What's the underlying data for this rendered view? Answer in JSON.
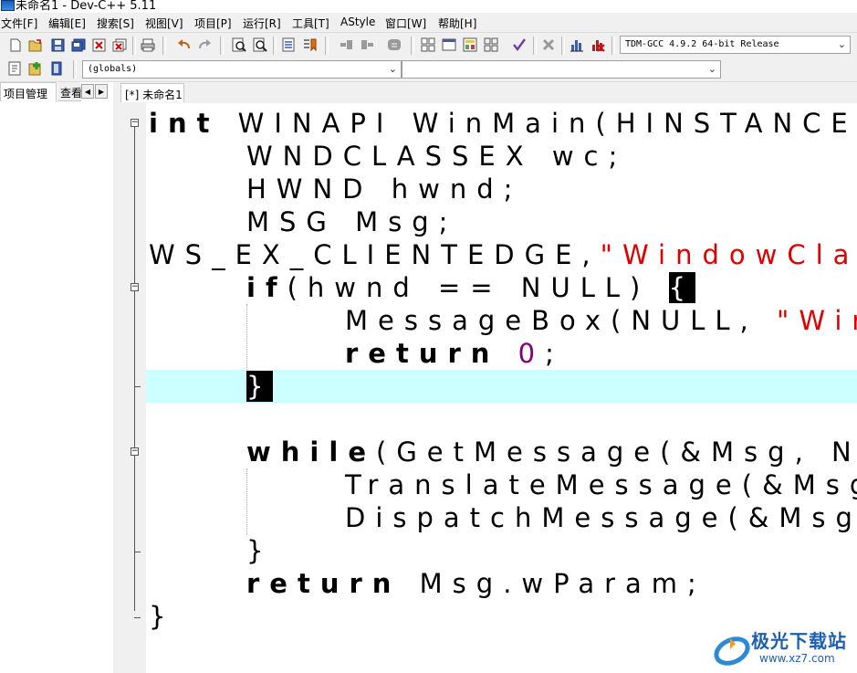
{
  "window": {
    "title": "未命名1 - Dev-C++ 5.11"
  },
  "menu": [
    "文件[F]",
    "编辑[E]",
    "搜索[S]",
    "视图[V]",
    "项目[P]",
    "运行[R]",
    "工具[T]",
    "AStyle",
    "窗口[W]",
    "帮助[H]"
  ],
  "toolbar": {
    "compiler_select": "TDM-GCC 4.9.2 64-bit Release",
    "scope_select": "(globals)",
    "member_select": ""
  },
  "left_panel": {
    "tabs": [
      "项目管理",
      "查看"
    ]
  },
  "editor": {
    "tab_label": "[*] 未命名1",
    "lines": {
      "l1": "int",
      "l1b": " WINAPI WinMain(HINSTANCE",
      "l2": "WNDCLASSEX wc;",
      "l3": "HWND hwnd;",
      "l4": "MSG Msg;",
      "l5a": "WS_EX_CLIENTEDGE,",
      "l5b": "\"WindowClass",
      "l6a": "if",
      "l6b": "(hwnd == NULL) ",
      "l6c": "{",
      "l7a": "MessageBox(NULL, ",
      "l7b": "\"Win",
      "l8a": "return",
      "l8b": " ",
      "l8c": "0",
      "l8d": ";",
      "l9": "}",
      "l11a": "while",
      "l11b": "(GetMessage(&Msg, NU",
      "l12": "TranslateMessage(&Msg",
      "l13": "DispatchMessage(&Msg)",
      "l14": "}",
      "l15a": "return",
      "l15b": " Msg.wParam;",
      "l16": "}"
    }
  },
  "watermark": {
    "brand": "极光下载站",
    "url": "www.xz7.com"
  },
  "colors": {
    "keyword": "#000000",
    "string": "#e00000",
    "number": "#800080",
    "current_line": "#ccffff"
  }
}
